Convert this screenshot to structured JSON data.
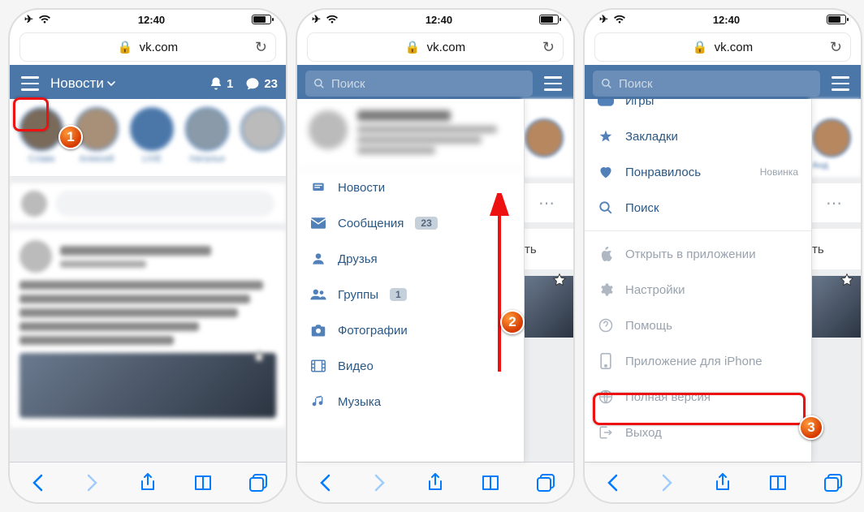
{
  "status": {
    "time": "12:40"
  },
  "url": {
    "domain": "vk.com"
  },
  "header1": {
    "title": "Новости",
    "notif_count": "1",
    "msg_count": "23"
  },
  "search": {
    "placeholder": "Поиск"
  },
  "stories1": [
    "Слава",
    "Алексей",
    "LIVE",
    "Наталья"
  ],
  "story_peek": "Анд",
  "menu": {
    "news": "Новости",
    "messages": "Сообщения",
    "messages_count": "23",
    "friends": "Друзья",
    "groups": "Группы",
    "groups_count": "1",
    "photos": "Фотографии",
    "video": "Видео",
    "music": "Музыка"
  },
  "menu3": {
    "games": "Игры",
    "bookmarks": "Закладки",
    "liked": "Понравилось",
    "liked_tag": "Новинка",
    "search": "Поиск",
    "open_app": "Открыть в приложении",
    "settings": "Настройки",
    "help": "Помощь",
    "iphone_app": "Приложение для iPhone",
    "full_version": "Полная версия",
    "logout": "Выход"
  },
  "peek_txt": "ть",
  "annotations": {
    "b1": "1",
    "b2": "2",
    "b3": "3"
  }
}
